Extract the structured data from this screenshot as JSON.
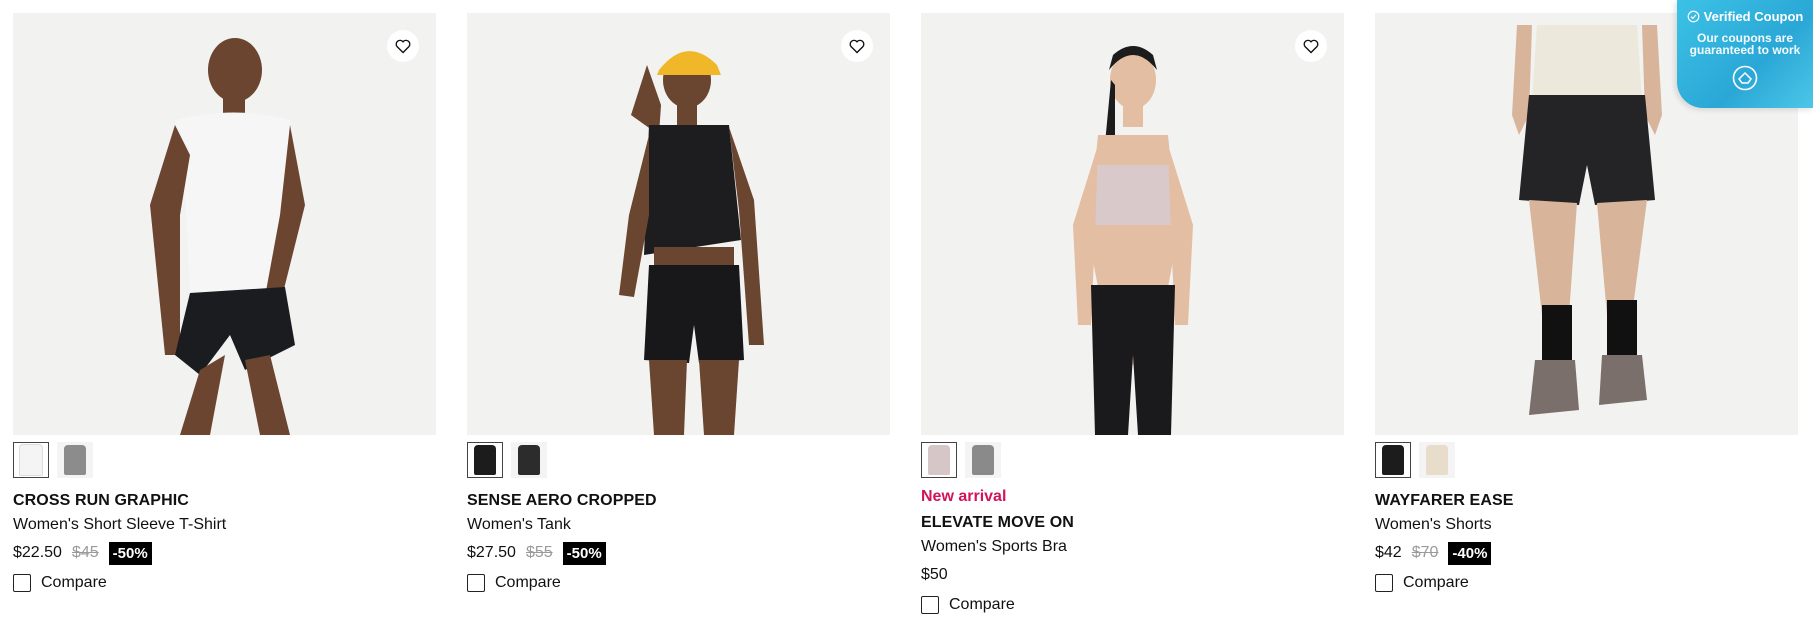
{
  "products": [
    {
      "brand_line": "CROSS RUN GRAPHIC",
      "subtitle": "Women's Short Sleeve T-Shirt",
      "price": "$22.50",
      "old_price": "$45",
      "discount": "-50%",
      "badge": "",
      "compare_label": "Compare",
      "swatch_colors": [
        "#f4f4f4",
        "#8c8c8c"
      ],
      "top_color": "#f6f6f6",
      "bottom_color": "#1b1c1f",
      "skin": "#6b4530"
    },
    {
      "brand_line": "SENSE AERO CROPPED",
      "subtitle": "Women's Tank",
      "price": "$27.50",
      "old_price": "$55",
      "discount": "-50%",
      "badge": "",
      "compare_label": "Compare",
      "swatch_colors": [
        "#1c1c1c",
        "#2c2c2c"
      ],
      "top_color": "#1d1d1f",
      "bottom_color": "#18181a",
      "skin": "#6a4530",
      "hat_color": "#f0b729"
    },
    {
      "brand_line": "ELEVATE MOVE ON",
      "subtitle": "Women's Sports Bra",
      "price": "$50",
      "old_price": "",
      "discount": "",
      "badge": "New arrival",
      "compare_label": "Compare",
      "swatch_colors": [
        "#d6c6c8",
        "#8a8a8a"
      ],
      "top_color": "#d9c9cb",
      "bottom_color": "#1a1a1c",
      "skin": "#e3bea2"
    },
    {
      "brand_line": "WAYFARER EASE",
      "subtitle": "Women's Shorts",
      "price": "$42",
      "old_price": "$70",
      "discount": "-40%",
      "badge": "",
      "compare_label": "Compare",
      "swatch_colors": [
        "#1c1c1c",
        "#e8dccb"
      ],
      "top_color": "#ece9dc",
      "bottom_color": "#242426",
      "skin": "#d8b59a"
    }
  ],
  "coupon": {
    "title": "Verified Coupon",
    "text": "Our coupons are guaranteed to work"
  },
  "icons": {
    "wishlist": "heart-icon",
    "coupon_check": "check-circle-icon",
    "coupon_logo": "coupon-logo-icon"
  }
}
